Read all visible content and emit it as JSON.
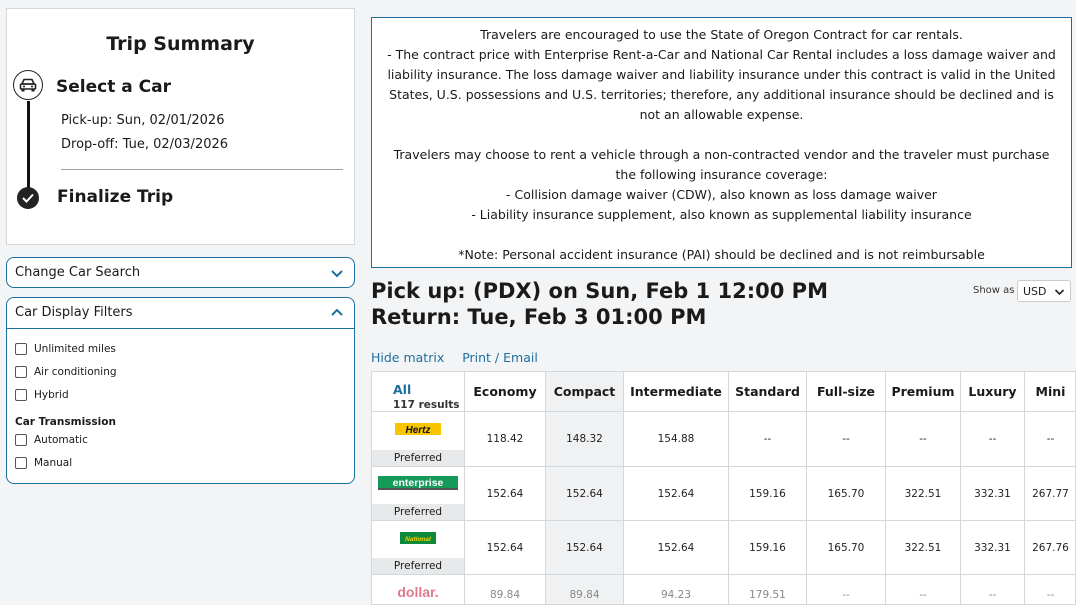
{
  "trip": {
    "title": "Trip Summary",
    "step1_label": "Select a Car",
    "pickup": "Pick-up: Sun, 02/01/2026",
    "dropoff": "Drop-off: Tue, 02/03/2026",
    "step2_label": "Finalize Trip"
  },
  "filters": {
    "change_search": "Change Car Search",
    "display_filters": "Car Display Filters",
    "options": [
      "Unlimited miles",
      "Air conditioning",
      "Hybrid"
    ],
    "transmission_heading": "Car Transmission",
    "transmission": [
      "Automatic",
      "Manual"
    ]
  },
  "notice": {
    "p1": "Travelers are encouraged to use the State of Oregon Contract for car rentals.",
    "p2": "- The contract price with Enterprise Rent-a-Car and National Car Rental includes a loss damage waiver and liability insurance. The loss damage waiver and liability insurance under this contract is valid in the United States, U.S. possessions and U.S. territories; therefore, any additional insurance should be declined and is not an allowable expense.",
    "p3": "Travelers may choose to rent a vehicle through a non-contracted vendor and the traveler must purchase the following insurance coverage:",
    "p4": "- Collision damage waiver (CDW), also known as loss damage waiver",
    "p5": "- Liability insurance supplement, also known as supplemental liability insurance",
    "p6": "*Note: Personal accident insurance (PAI) should be declined and is not reimbursable"
  },
  "header": {
    "pickup": "Pick up: (PDX) on Sun, Feb 1 12:00 PM",
    "return": "Return: Tue, Feb 3 01:00 PM",
    "show_as": "Show as",
    "currency": "USD",
    "hide_matrix": "Hide matrix",
    "print_email": "Print / Email"
  },
  "matrix": {
    "all": "All",
    "results": "117 results",
    "columns": [
      "Economy",
      "Compact",
      "Intermediate",
      "Standard",
      "Full-size",
      "Premium",
      "Luxury",
      "Mini"
    ],
    "preferred": "Preferred",
    "rows": [
      {
        "vendor": "Hertz",
        "logo_color": "#f7c600",
        "values": [
          "118.42",
          "148.32",
          "154.88",
          "--",
          "--",
          "--",
          "--",
          "--"
        ]
      },
      {
        "vendor": "enterprise",
        "logo_color": "#169a5a",
        "values": [
          "152.64",
          "152.64",
          "152.64",
          "159.16",
          "165.70",
          "322.51",
          "332.31",
          "267.77"
        ]
      },
      {
        "vendor": "National",
        "logo_color": "#0c8a3a",
        "values": [
          "152.64",
          "152.64",
          "152.64",
          "159.16",
          "165.70",
          "322.51",
          "332.31",
          "267.76"
        ]
      },
      {
        "vendor": "dollar.",
        "logo_color": "#d6203b",
        "values": [
          "89.84",
          "89.84",
          "94.23",
          "179.51",
          "--",
          "--",
          "--",
          "--"
        ]
      }
    ]
  }
}
